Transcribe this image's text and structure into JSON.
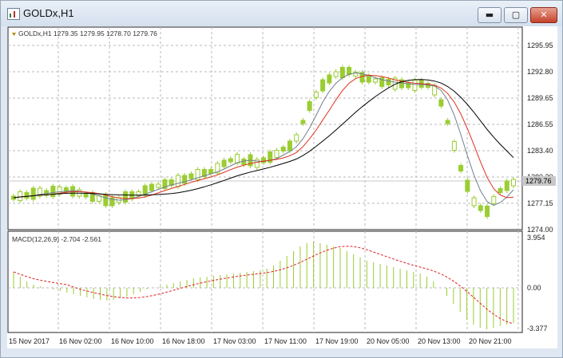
{
  "window": {
    "title": "GOLDx,H1",
    "controls": {
      "minimize": "▬",
      "maximize": "▢",
      "close": "✕"
    }
  },
  "chart": {
    "info_line": "GOLDx,H1  1279.35 1279.95 1278.70 1279.76",
    "current_price": "1279.76",
    "price_axis_labels": [
      "1295.95",
      "1292.80",
      "1289.65",
      "1286.55",
      "1283.40",
      "1280.30",
      "1277.15",
      "1274.00"
    ],
    "macd_label": "MACD(12,26,9) -2.704 -2.561",
    "macd_axis_labels": [
      "3.954",
      "0.00",
      "-3.377"
    ],
    "time_labels": [
      "15 Nov 2017",
      "16 Nov 02:00",
      "16 Nov 10:00",
      "16 Nov 18:00",
      "17 Nov 03:00",
      "17 Nov 11:00",
      "17 Nov 19:00",
      "20 Nov 05:00",
      "20 Nov 13:00",
      "20 Nov 21:00"
    ]
  },
  "colors": {
    "bull_candle": "#9acd32",
    "bear_candle": "#9acd32",
    "grid": "#b8b8b8",
    "axis_text": "#222222",
    "ma_fast": "#708090",
    "ma_mid": "#e03020",
    "ma_slow": "#000000",
    "macd_hist": "#9acd32",
    "macd_signal": "#e02020",
    "price_marker": "#c8c8c8"
  }
}
